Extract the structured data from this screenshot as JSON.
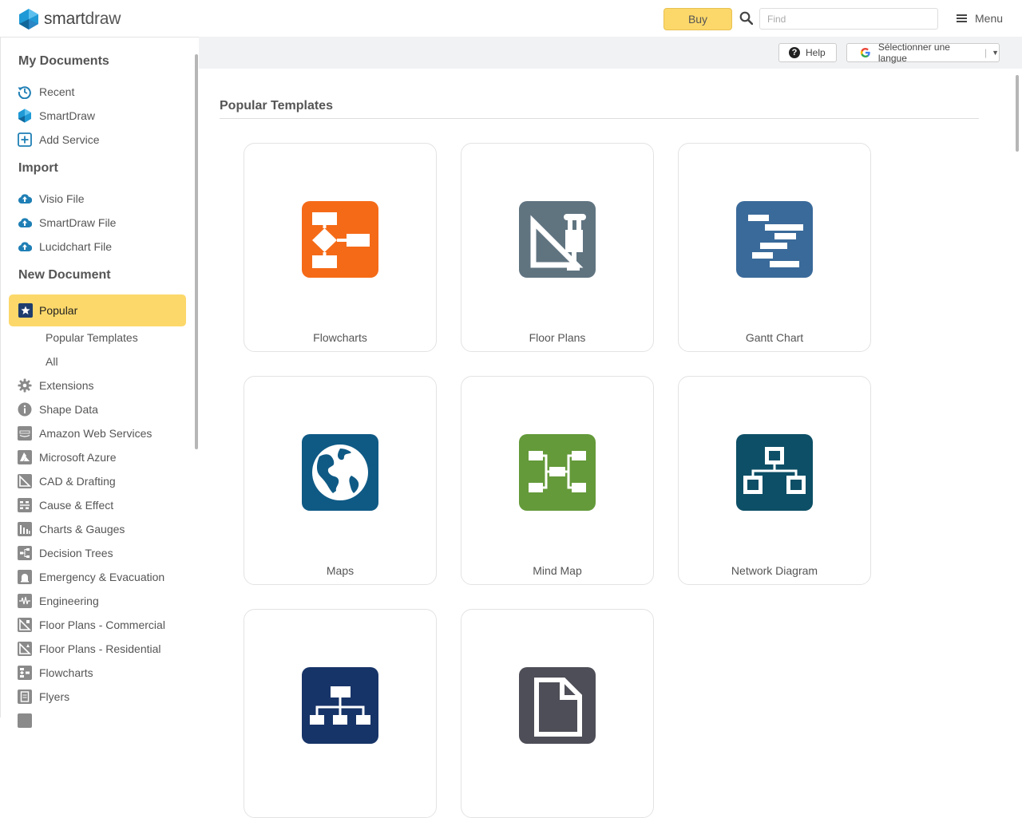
{
  "header": {
    "logo_text_bold": "smart",
    "logo_text_rest": "draw",
    "buy_label": "Buy",
    "find_placeholder": "Find",
    "menu_label": "Menu"
  },
  "sidebar": {
    "my_documents": {
      "heading": "My Documents",
      "items": [
        {
          "label": "Recent",
          "icon": "history-icon"
        },
        {
          "label": "SmartDraw",
          "icon": "smartdraw-logo-icon"
        },
        {
          "label": "Add Service",
          "icon": "plus-box-icon"
        }
      ]
    },
    "import": {
      "heading": "Import",
      "items": [
        {
          "label": "Visio File",
          "icon": "cloud-upload-icon"
        },
        {
          "label": "SmartDraw File",
          "icon": "cloud-upload-icon"
        },
        {
          "label": "Lucidchart File",
          "icon": "cloud-upload-icon"
        }
      ]
    },
    "new_document": {
      "heading": "New Document",
      "selected": "Popular",
      "sub_items": [
        "Popular Templates",
        "All"
      ],
      "categories": [
        "Extensions",
        "Shape Data",
        "Amazon Web Services",
        "Microsoft Azure",
        "CAD & Drafting",
        "Cause & Effect",
        "Charts & Gauges",
        "Decision Trees",
        "Emergency & Evacuation",
        "Engineering",
        "Floor Plans - Commercial",
        "Floor Plans - Residential",
        "Flowcharts",
        "Flyers"
      ]
    }
  },
  "toolbar": {
    "help_label": "Help",
    "language_label": "Sélectionner une langue"
  },
  "main": {
    "section_title": "Popular Templates",
    "templates": [
      {
        "label": "Flowcharts",
        "color": "#f56a17",
        "icon": "flowchart-icon"
      },
      {
        "label": "Floor Plans",
        "color": "#607480",
        "icon": "drafting-triangle-icon"
      },
      {
        "label": "Gantt Chart",
        "color": "#3a6a9a",
        "icon": "gantt-icon"
      },
      {
        "label": "Maps",
        "color": "#0f5a85",
        "icon": "globe-icon"
      },
      {
        "label": "Mind Map",
        "color": "#649a3a",
        "icon": "mind-map-icon"
      },
      {
        "label": "Network Diagram",
        "color": "#0d4f66",
        "icon": "network-icon"
      },
      {
        "label": "",
        "color": "#173468",
        "icon": "org-chart-icon"
      },
      {
        "label": "",
        "color": "#4e4e58",
        "icon": "blank-document-icon"
      }
    ]
  },
  "colors": {
    "accent_yellow": "#fcd86a",
    "brand_blue": "#1f9ad6"
  }
}
